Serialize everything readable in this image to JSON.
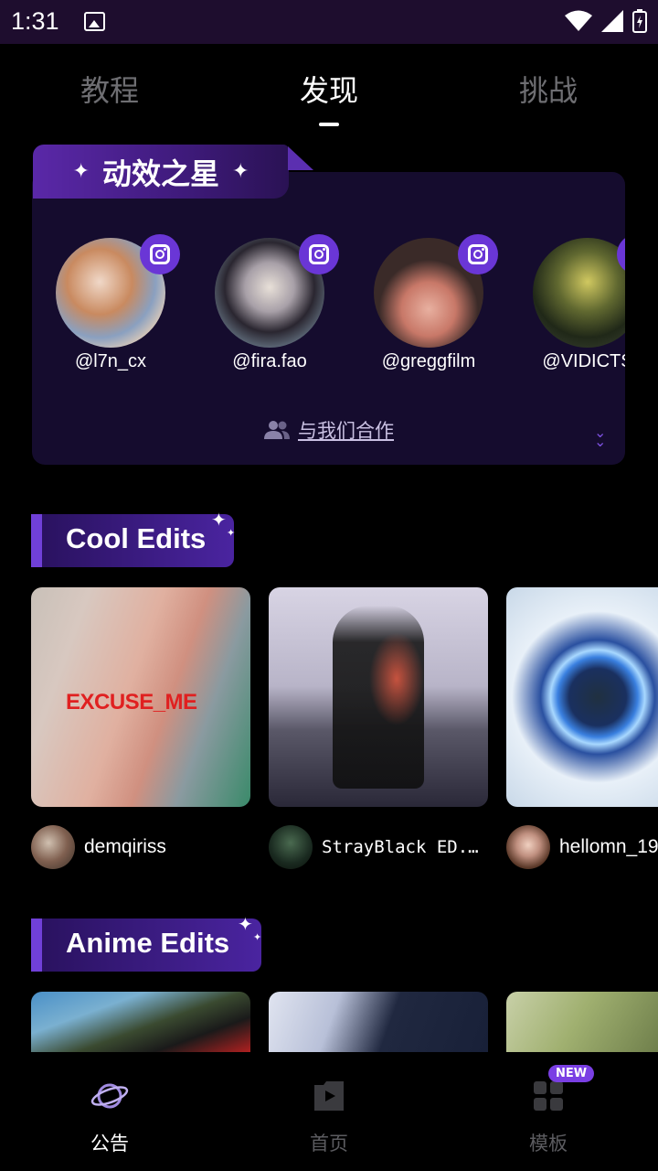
{
  "status_bar": {
    "time": "1:31"
  },
  "top_tabs": [
    {
      "label": "教程",
      "active": false
    },
    {
      "label": "发现",
      "active": true
    },
    {
      "label": "挑战",
      "active": false
    }
  ],
  "star_card": {
    "title": "动效之星",
    "creators": [
      {
        "handle": "@l7n_cx"
      },
      {
        "handle": "@fira.fao"
      },
      {
        "handle": "@greggfilm"
      },
      {
        "handle": "@VIDICTS"
      }
    ],
    "collab_label": "与我们合作"
  },
  "cool_edits": {
    "title": "Cool Edits",
    "items": [
      {
        "overlay_text": "EXCUSE_ME",
        "owner": "demqiriss"
      },
      {
        "overlay_text": "",
        "owner": "StrayBlack ED..."
      },
      {
        "overlay_text": "",
        "owner": "hellomn_19"
      }
    ]
  },
  "anime_edits": {
    "title": "Anime Edits"
  },
  "bottom_nav": [
    {
      "label": "公告",
      "icon": "planet-icon",
      "active": true
    },
    {
      "label": "首页",
      "icon": "play-icon",
      "active": false
    },
    {
      "label": "模板",
      "icon": "grid-icon",
      "active": false
    }
  ],
  "new_badge": "NEW",
  "colors": {
    "accent": "#6a36d6",
    "card_bg": "#150c2e",
    "status_bg": "#1e0d2e"
  }
}
